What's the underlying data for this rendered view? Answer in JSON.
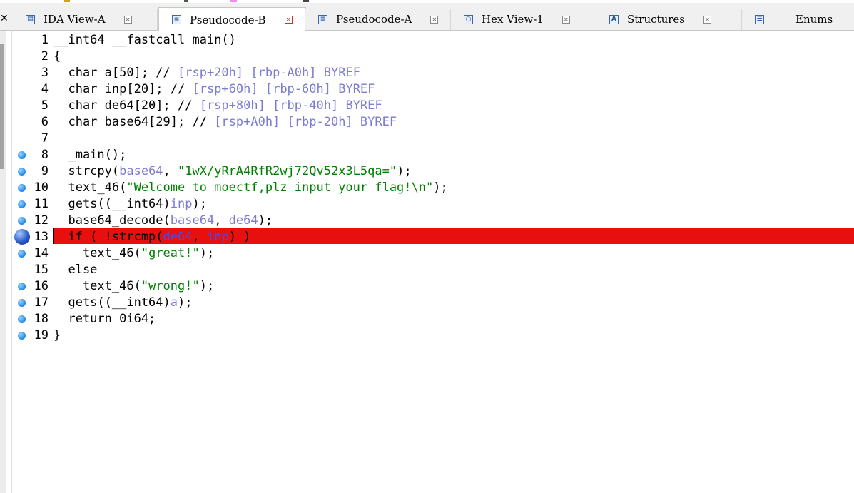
{
  "tabs": [
    {
      "label": "IDA View-A",
      "icon": "ida-view-icon",
      "active": false
    },
    {
      "label": "Pseudocode-B",
      "icon": "pseudocode-icon",
      "active": true
    },
    {
      "label": "Pseudocode-A",
      "icon": "pseudocode-icon",
      "active": false
    },
    {
      "label": "Hex View-1",
      "icon": "hex-view-icon",
      "active": false
    },
    {
      "label": "Structures",
      "icon": "structures-icon",
      "active": false
    },
    {
      "label": "Enums",
      "icon": "enums-icon",
      "active": false
    }
  ],
  "colors": {
    "highlight": "#e80f0f",
    "breakpoint": "#1a86e8",
    "string": "#008000",
    "gray": "#7b7bd1"
  },
  "lines": [
    {
      "n": "1",
      "bp": false,
      "text": "__int64 __fastcall main()"
    },
    {
      "n": "2",
      "bp": false,
      "text": "{"
    },
    {
      "n": "3",
      "bp": false,
      "text": "  char a[50]; // [rsp+20h] [rbp-A0h] BYREF"
    },
    {
      "n": "4",
      "bp": false,
      "text": "  char inp[20]; // [rsp+60h] [rbp-60h] BYREF"
    },
    {
      "n": "5",
      "bp": false,
      "text": "  char de64[20]; // [rsp+80h] [rbp-40h] BYREF"
    },
    {
      "n": "6",
      "bp": false,
      "text": "  char base64[29]; // [rsp+A0h] [rbp-20h] BYREF"
    },
    {
      "n": "7",
      "bp": false,
      "text": ""
    },
    {
      "n": "8",
      "bp": true,
      "text": "  _main();"
    },
    {
      "n": "9",
      "bp": true,
      "text": "  strcpy(base64, \"1wX/yRrA4RfR2wj72Qv52x3L5qa=\");"
    },
    {
      "n": "10",
      "bp": true,
      "text": "  text_46(\"Welcome to moectf,plz input your flag!\\n\");"
    },
    {
      "n": "11",
      "bp": true,
      "text": "  gets((__int64)inp);"
    },
    {
      "n": "12",
      "bp": true,
      "text": "  base64_decode(base64, de64);"
    },
    {
      "n": "13",
      "bp": true,
      "highlight": true,
      "text": "  if ( !strcmp(de64, inp) )"
    },
    {
      "n": "14",
      "bp": true,
      "text": "    text_46(\"great!\");"
    },
    {
      "n": "15",
      "bp": false,
      "text": "  else"
    },
    {
      "n": "16",
      "bp": true,
      "text": "    text_46(\"wrong!\");"
    },
    {
      "n": "17",
      "bp": true,
      "text": "  gets((__int64)a);"
    },
    {
      "n": "18",
      "bp": true,
      "text": "  return 0i64;"
    },
    {
      "n": "19",
      "bp": true,
      "text": "}"
    }
  ]
}
